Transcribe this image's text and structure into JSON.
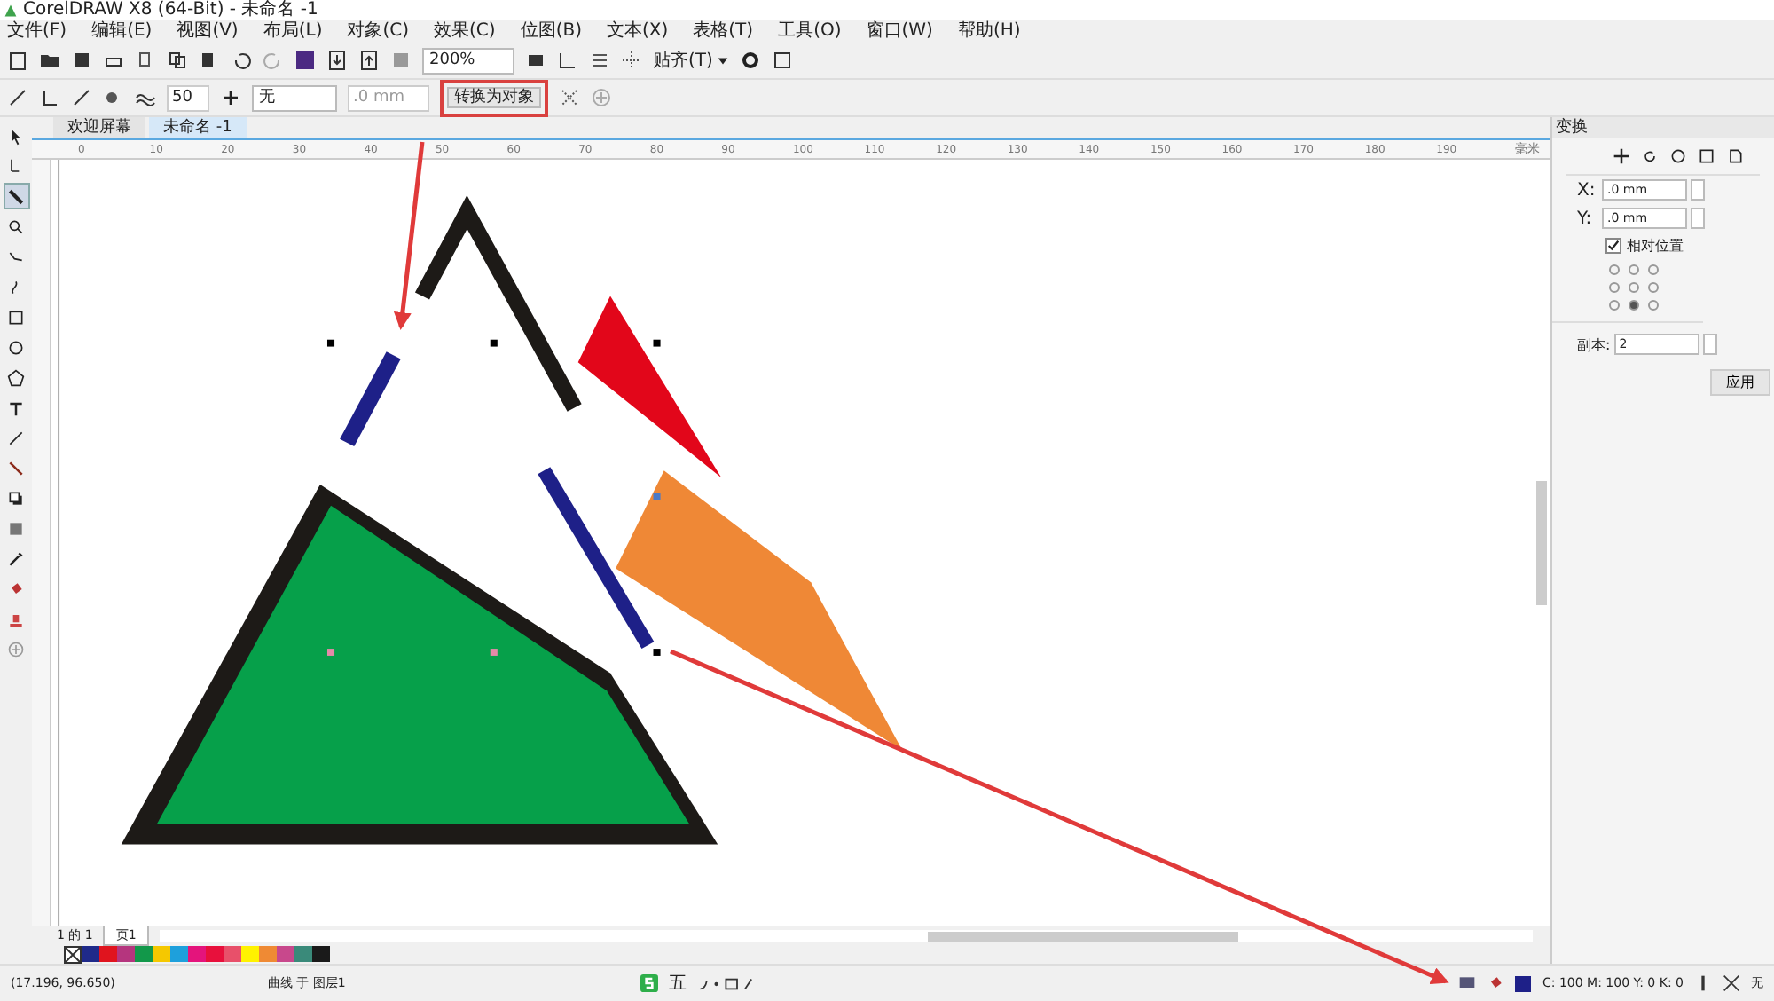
{
  "window": {
    "title": "CorelDRAW X8 (64-Bit) - 未命名 -1"
  },
  "menu": [
    "文件(F)",
    "编辑(E)",
    "视图(V)",
    "布局(L)",
    "对象(C)",
    "效果(C)",
    "位图(B)",
    "文本(X)",
    "表格(T)",
    "工具(O)",
    "窗口(W)",
    "帮助(H)"
  ],
  "toolbar": {
    "zoom": "200%",
    "snap": "贴齐(T)"
  },
  "property_bar": {
    "smoothness": "50",
    "outline": "无",
    "width": ".0 mm",
    "convert": "转换为对象"
  },
  "doc_tabs": [
    {
      "label": "欢迎屏幕",
      "selected": false
    },
    {
      "label": "未命名 -1",
      "selected": true
    }
  ],
  "ruler": {
    "labels": [
      "0",
      "10",
      "20",
      "30",
      "40",
      "50",
      "60",
      "70",
      "80",
      "90",
      "100",
      "110",
      "120",
      "130",
      "140",
      "150",
      "160",
      "170",
      "180",
      "190"
    ],
    "unit": "毫米"
  },
  "tools": [
    {
      "kind": "pick",
      "selected": false
    },
    {
      "kind": "shape",
      "selected": false
    },
    {
      "kind": "crop",
      "selected": true
    },
    {
      "kind": "zoom",
      "selected": false
    },
    {
      "kind": "freehand",
      "selected": false
    },
    {
      "kind": "artistic",
      "selected": false
    },
    {
      "kind": "rect",
      "selected": false
    },
    {
      "kind": "ellipse",
      "selected": false
    },
    {
      "kind": "polygon",
      "selected": false
    },
    {
      "kind": "text",
      "selected": false
    },
    {
      "kind": "line",
      "selected": false
    },
    {
      "kind": "connector",
      "selected": false
    },
    {
      "kind": "shadow",
      "selected": false
    },
    {
      "kind": "transparency",
      "selected": false
    },
    {
      "kind": "eyedropper",
      "selected": false
    },
    {
      "kind": "fill",
      "selected": false
    },
    {
      "kind": "smartfill",
      "selected": false
    },
    {
      "kind": "add",
      "selected": false
    }
  ],
  "page_nav": {
    "page_of": "1 的 1",
    "page_tab": "页1"
  },
  "palette": [
    {
      "color": "#1f2a8a"
    },
    {
      "color": "#e0141e"
    },
    {
      "color": "#b5357e"
    },
    {
      "color": "#12984a"
    },
    {
      "color": "#f5c800"
    },
    {
      "color": "#1ea0dc"
    },
    {
      "color": "#e4147c"
    },
    {
      "color": "#e8103c"
    },
    {
      "color": "#e8506a"
    },
    {
      "color": "#fff200"
    },
    {
      "color": "#ef8a34"
    },
    {
      "color": "#c8488c"
    },
    {
      "color": "#3a8a7a"
    },
    {
      "color": "#1a1a1a"
    }
  ],
  "docker": {
    "title": "变换",
    "x_label": "X:",
    "x": ".0 mm",
    "y_label": "Y:",
    "y": ".0 mm",
    "relative": {
      "label": "相对位置",
      "checked": true
    },
    "anchors": [
      {
        "selected": false
      },
      {
        "selected": false
      },
      {
        "selected": false
      },
      {
        "selected": false
      },
      {
        "selected": false
      },
      {
        "selected": false
      },
      {
        "selected": false
      },
      {
        "selected": true
      },
      {
        "selected": false
      }
    ],
    "copies_label": "副本:",
    "copies": "2",
    "apply": "应用"
  },
  "status": {
    "coords": "(17.196, 96.650)",
    "object": "曲线 于 图层1",
    "ime": "五",
    "fill_info": "C: 100 M: 100 Y: 0 K: 0",
    "outline": "无"
  }
}
